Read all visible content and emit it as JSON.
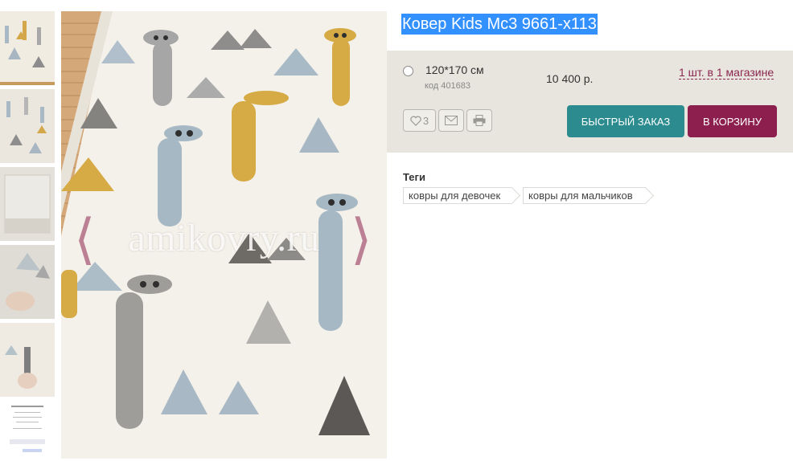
{
  "product": {
    "title": "Ковер Kids Mc3 9661-x113",
    "watermark": "amikovry.ru"
  },
  "offer": {
    "size": "120*170 см",
    "code": "код 401683",
    "price": "10 400 р.",
    "stock_link": "1 шт. в 1 магазине"
  },
  "actions": {
    "favorites_count": "3",
    "quick_order_label": "БЫСТРЫЙ ЗАКАЗ",
    "cart_label": "В КОРЗИНУ"
  },
  "tags": {
    "title": "Теги",
    "items": [
      "ковры для девочек",
      "ковры для мальчиков"
    ]
  },
  "icons": {
    "favorite": "heart-icon",
    "mail": "mail-icon",
    "print": "printer-icon"
  },
  "colors": {
    "quick_order_bg": "#2b8b8f",
    "cart_bg": "#8d1f4f",
    "panel_bg": "#e8e5de",
    "link": "#8b2650"
  }
}
